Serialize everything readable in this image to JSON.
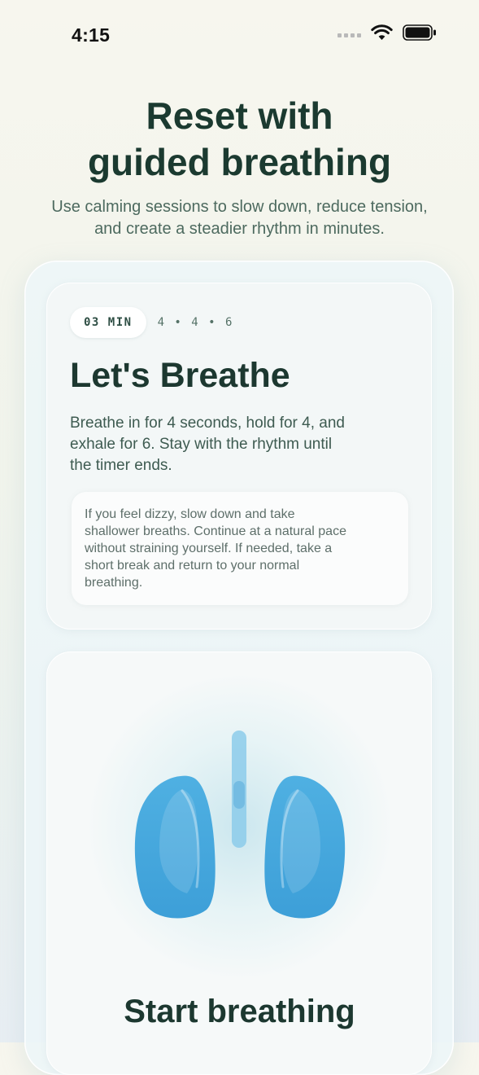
{
  "status_bar": {
    "time": "4:15",
    "icons": [
      "signal-dots-icon",
      "wifi-icon",
      "battery-icon"
    ]
  },
  "hero": {
    "title_line1": "Reset with",
    "title_line2": "guided breathing",
    "subtitle_line1": "Use calming sessions to slow down, reduce tension,",
    "subtitle_line2": "and create a steadier rhythm in minutes."
  },
  "session": {
    "duration_chip": "03 MIN",
    "rhythm": "4 • 4 • 6",
    "title": "Let's Breathe",
    "description_lines": [
      "Breathe in for 4 seconds, hold for 4, and",
      "exhale for 6. Stay with the rhythm until",
      "the timer ends."
    ],
    "note_lines": [
      "If you feel dizzy, slow down and take",
      "shallower breaths. Continue at a natural pace",
      "without straining yourself. If needed, take a",
      "short break and return to your normal",
      "breathing."
    ]
  },
  "breathe_panel": {
    "illustration": "lungs-icon",
    "start_label": "Start breathing"
  },
  "colors": {
    "title": "#1b3a30",
    "subtitle": "#4d6a5f",
    "lungs": "#4aa8dc",
    "card_bg": "#f3f7f7"
  }
}
